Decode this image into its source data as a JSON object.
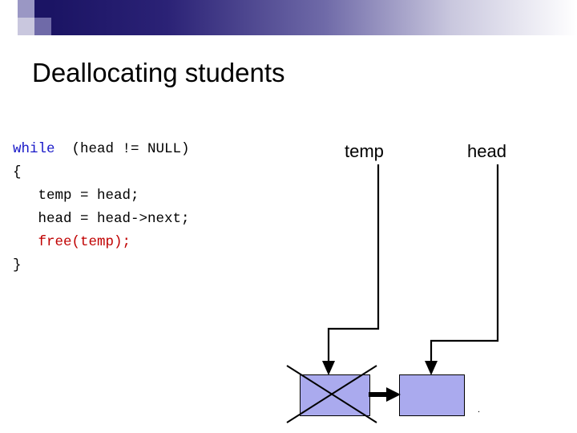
{
  "slide": {
    "title": "Deallocating students"
  },
  "code": {
    "lines": [
      {
        "segments": [
          {
            "text": "while",
            "style": "kw"
          },
          {
            "text": "  (head != NULL)",
            "style": "plain"
          }
        ]
      },
      {
        "segments": [
          {
            "text": "{",
            "style": "plain"
          }
        ]
      },
      {
        "segments": [
          {
            "text": "   temp = head;",
            "style": "plain"
          }
        ]
      },
      {
        "segments": [
          {
            "text": "   head = head->next;",
            "style": "plain"
          }
        ]
      },
      {
        "segments": [
          {
            "text": "   free(temp);",
            "style": "fn"
          }
        ]
      },
      {
        "segments": [
          {
            "text": "}",
            "style": "plain"
          }
        ]
      }
    ]
  },
  "diagram": {
    "labels": {
      "temp": "temp",
      "head": "head"
    },
    "nodes": [
      {
        "name": "temp-node",
        "crossed_out": true
      },
      {
        "name": "head-node",
        "crossed_out": false
      }
    ],
    "period": "."
  },
  "colors": {
    "keyword": "#1818c8",
    "function": "#c00000",
    "node_fill": "#aaaaee",
    "band_dark": "#1b1464",
    "band_light": "#c9c7de"
  }
}
